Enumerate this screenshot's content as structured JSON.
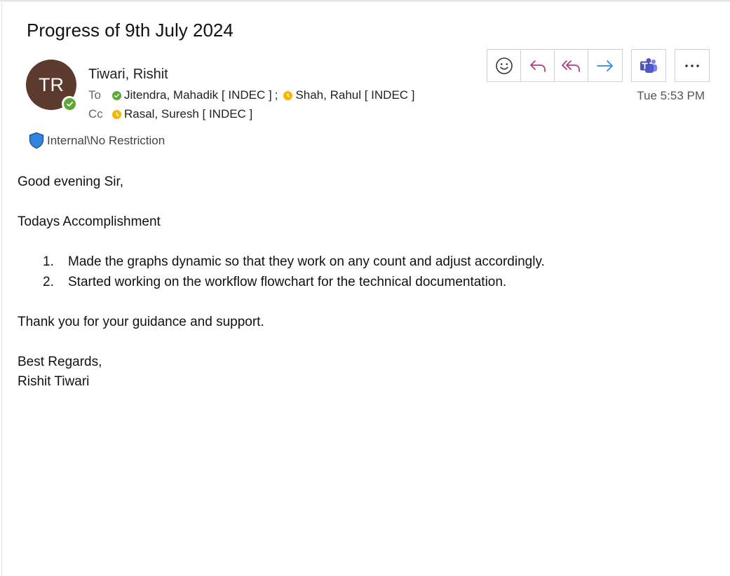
{
  "email": {
    "subject": "Progress of 9th July 2024",
    "sender": {
      "initials": "TR",
      "name": "Tiwari, Rishit",
      "avatar_color": "#5d3a2e",
      "presence": "available",
      "presence_color": "#5ea836"
    },
    "to_label": "To",
    "cc_label": "Cc",
    "to": [
      {
        "name": "Jitendra, Mahadik [ INDEC ]",
        "separator": ";",
        "status": "available"
      },
      {
        "name": "Shah, Rahul [ INDEC ]",
        "separator": "",
        "status": "away"
      }
    ],
    "cc": [
      {
        "name": "Rasal, Suresh [ INDEC ]",
        "status": "away"
      }
    ],
    "timestamp": "Tue 5:53 PM",
    "sensitivity": "Internal\\No Restriction",
    "body": {
      "greeting": "Good evening Sir,",
      "section_title": "Todays Accomplishment",
      "items": [
        {
          "num": "1.",
          "text": "Made the graphs dynamic so that they work on any count and adjust accordingly."
        },
        {
          "num": "2.",
          "text": "Started working on the workflow flowchart for the technical documentation."
        }
      ],
      "thanks": "Thank you for your guidance and support.",
      "closing": "Best Regards,",
      "signature": "Rishit Tiwari"
    }
  },
  "toolbar": {
    "buttons": [
      {
        "name": "react-button",
        "icon": "smiley-icon"
      },
      {
        "name": "reply-button",
        "icon": "reply-icon"
      },
      {
        "name": "reply-all-button",
        "icon": "reply-all-icon"
      },
      {
        "name": "forward-button",
        "icon": "forward-arrow-icon"
      },
      {
        "name": "teams-button",
        "icon": "teams-icon"
      },
      {
        "name": "more-actions-button",
        "icon": "ellipsis-icon"
      }
    ],
    "colors": {
      "reply": "#b4387e",
      "forward": "#2b88d8",
      "teams": "#4b53bc"
    }
  }
}
